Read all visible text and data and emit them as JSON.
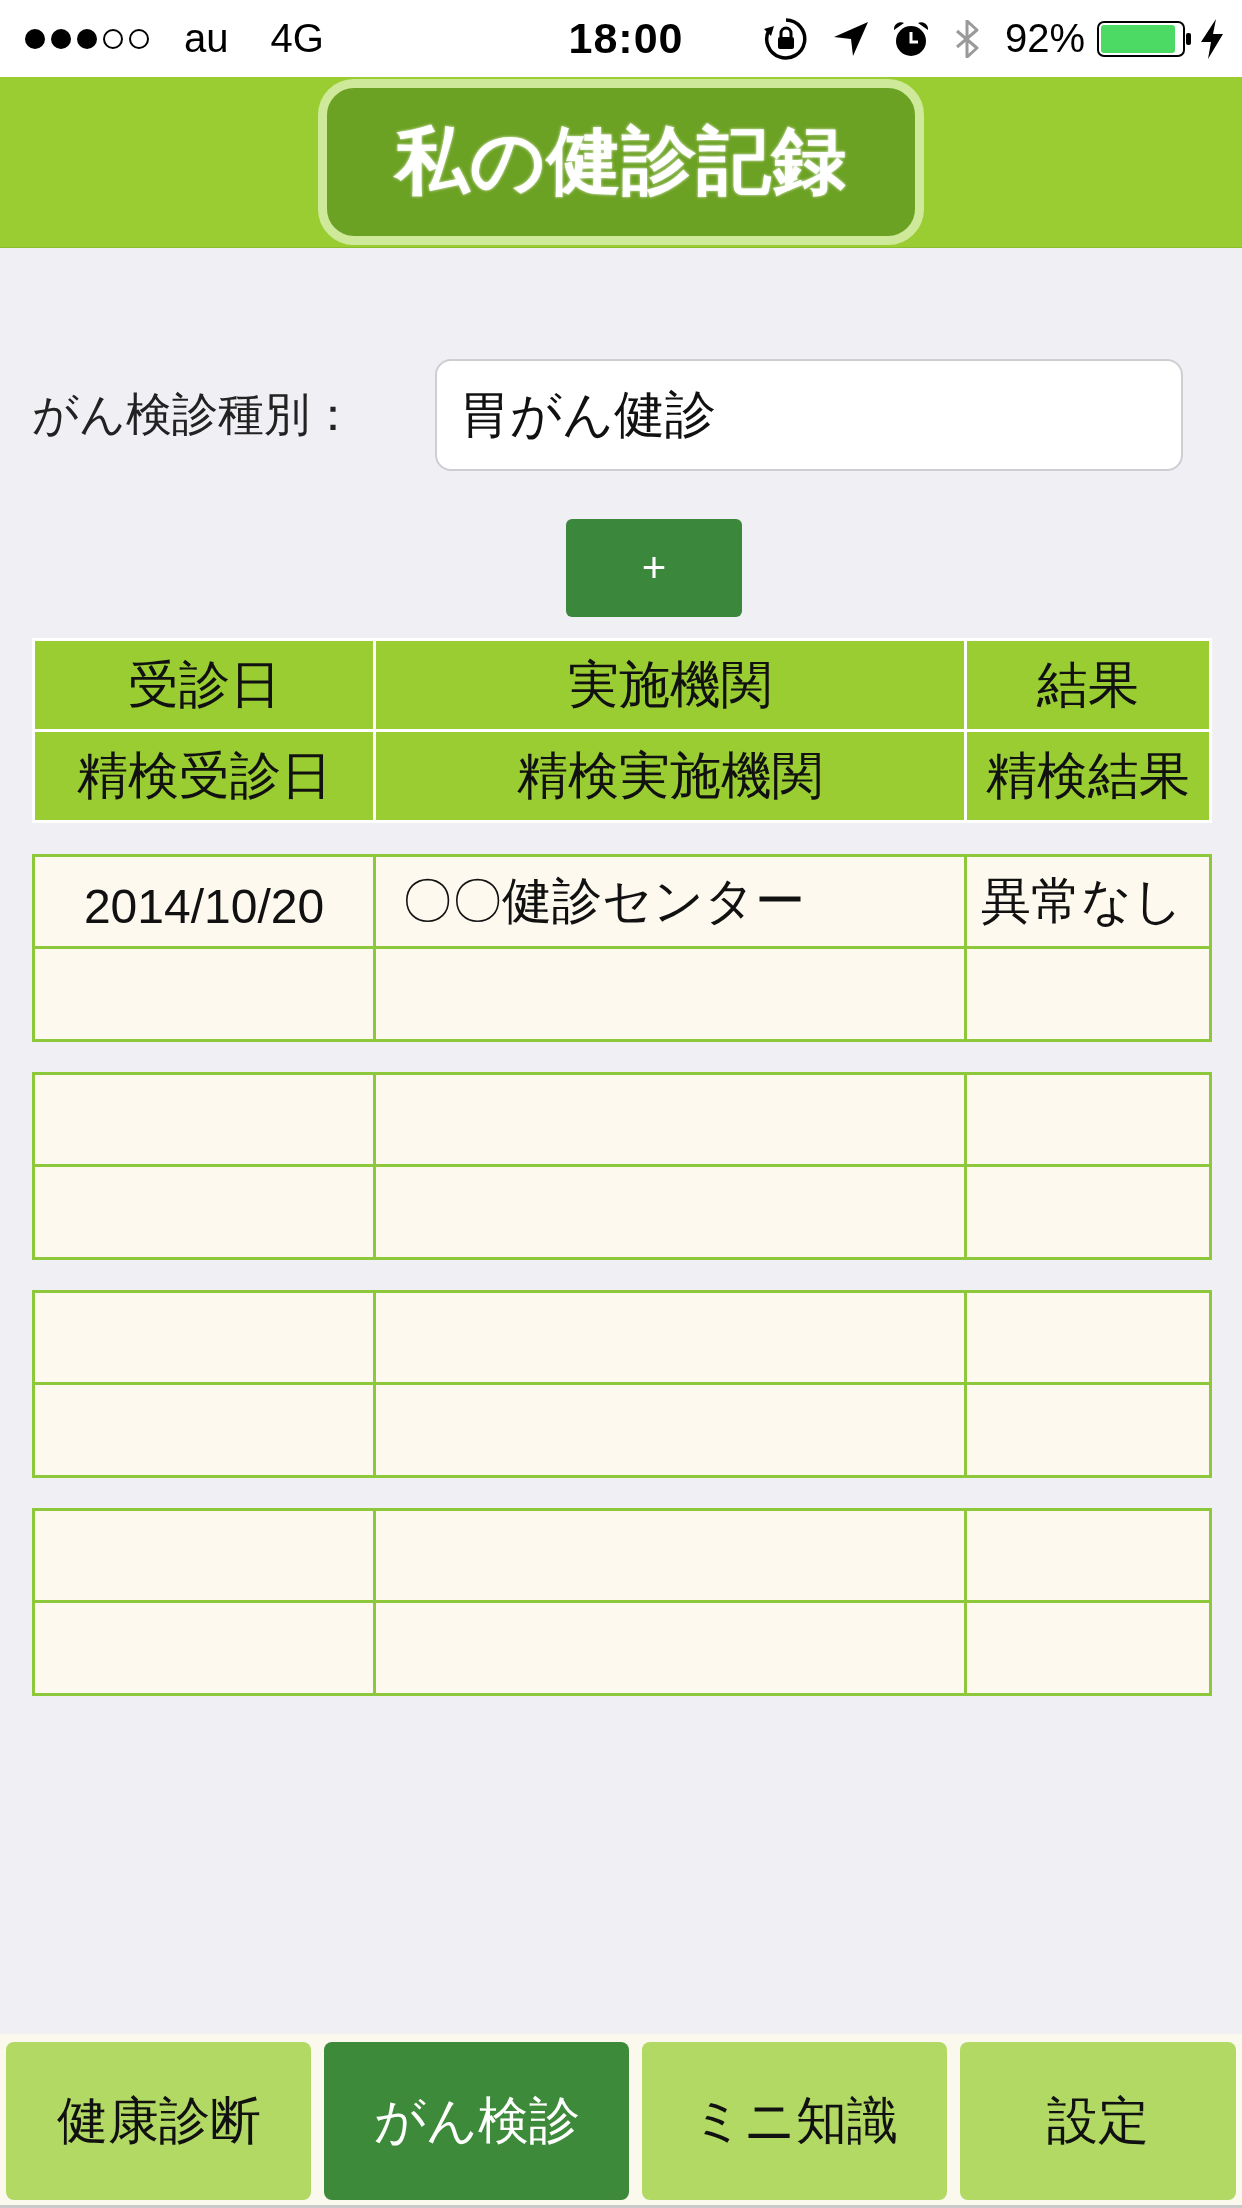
{
  "status_bar": {
    "carrier": "au",
    "network": "4G",
    "time": "18:00",
    "battery": "92%"
  },
  "header": {
    "title": "私の健診記録"
  },
  "form": {
    "label": "がん検診種別：",
    "value": "胃がん健診"
  },
  "add_button": {
    "label": "+"
  },
  "table": {
    "columns": [
      {
        "label": "受診日",
        "sub_label": "精検受診日"
      },
      {
        "label": "実施機関",
        "sub_label": "精検実施機関"
      },
      {
        "label": "結果",
        "sub_label": "精検結果"
      }
    ],
    "records": [
      {
        "kind": "entry",
        "date": "2014/10/20",
        "institution": "〇〇健診センター",
        "result": "異常なし"
      },
      {
        "kind": "blank"
      },
      {
        "kind": "blank"
      },
      {
        "kind": "blank"
      }
    ]
  },
  "tab_bar": {
    "tabs": [
      {
        "label": "健康診断",
        "selected": false
      },
      {
        "label": "がん検診",
        "selected": true
      },
      {
        "label": "ミニ知識",
        "selected": false
      },
      {
        "label": "設定",
        "selected": false
      }
    ]
  }
}
